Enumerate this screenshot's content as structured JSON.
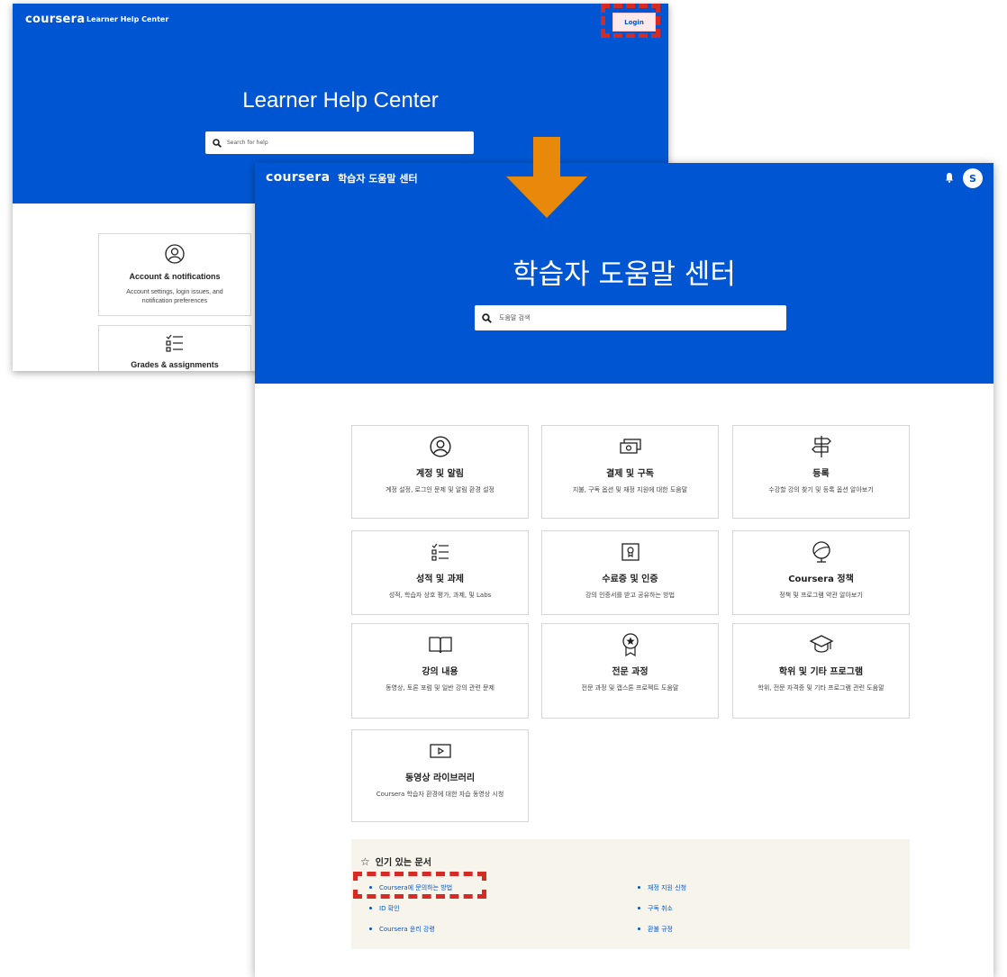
{
  "back_window": {
    "logo": "coursera",
    "title_small": "Learner Help Center",
    "login_label": "Login",
    "hero_title": "Learner Help Center",
    "search_placeholder": "Search for help",
    "cards": [
      {
        "title": "Account & notifications",
        "desc": "Account settings, login issues, and notification preferences",
        "icon": "user-circle-icon"
      },
      {
        "title": "Grades & assignments",
        "desc": "",
        "icon": "checklist-icon"
      }
    ]
  },
  "front_window": {
    "logo": "coursera",
    "title_small": "학습자 도움말 센터",
    "avatar_initial": "S",
    "hero_title": "학습자 도움말 센터",
    "search_placeholder": "도움말 검색",
    "cards": [
      {
        "title": "계정 및 알림",
        "desc": "계정 설정, 로그인 문제 및 알림 환경 설정",
        "icon": "user-circle-icon"
      },
      {
        "title": "결제 및 구독",
        "desc": "지불, 구독 옵션 및 재정 지원에 대한 도움말",
        "icon": "money-icon"
      },
      {
        "title": "등록",
        "desc": "수강할 강의 찾기 및 등록 옵션 알아보기",
        "icon": "signpost-icon"
      },
      {
        "title": "성적 및 과제",
        "desc": "성적, 학습자 상호 평가, 과제, 및 Labs",
        "icon": "checklist-icon"
      },
      {
        "title": "수료증 및 인증",
        "desc": "강의 인증서를 받고 공유하는 방법",
        "icon": "certificate-icon"
      },
      {
        "title": "Coursera 정책",
        "desc": "정책 및 프로그램 약관 알아보기",
        "icon": "globe-icon"
      },
      {
        "title": "강의 내용",
        "desc": "동영상, 토론 포럼 및 일반 강의 관련 문제",
        "icon": "book-icon"
      },
      {
        "title": "전문 과정",
        "desc": "전문 과정 및 캡스톤 프로젝트 도움말",
        "icon": "award-icon"
      },
      {
        "title": "학위 및 기타 프로그램",
        "desc": "학위, 전문 자격증 및 기타 프로그램 관련 도움말",
        "icon": "graduation-cap-icon"
      },
      {
        "title": "동영상 라이브러리",
        "desc": "Coursera 학습자 환경에 대한 자습 동영상 시청",
        "icon": "video-play-icon"
      }
    ],
    "popular": {
      "heading": "인기 있는 문서",
      "left": [
        "Coursera에 문의하는 방법",
        "ID 확인",
        "Coursera 윤리 강령"
      ],
      "right": [
        "재정 지원 신청",
        "구독 취소",
        "환불 규정"
      ]
    }
  },
  "colors": {
    "brand_blue": "#0056d2",
    "annotation_red": "#d62a24",
    "arrow_orange": "#e8890c",
    "popular_bg": "#f7f4ec"
  }
}
